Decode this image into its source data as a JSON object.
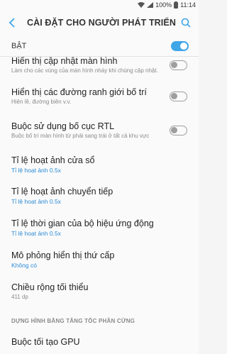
{
  "status": {
    "battery": "100%",
    "time": "11:14"
  },
  "appbar": {
    "title": "CÀI ĐẶT CHO NGƯỜI PHÁT TRIỂN"
  },
  "master": {
    "label": "BẬT"
  },
  "items": [
    {
      "title": "Hiển thị cập nhật màn hình",
      "subtitle": "Làm cho các vùng của màn hình nháy khi chúng cập nhật."
    },
    {
      "title": "Hiển thị các đường ranh giới bố trí",
      "subtitle": "Hiện lề, đường biên v.v."
    },
    {
      "title": "Buộc sử dụng bố cục RTL",
      "subtitle": "Buộc bố trí màn hình từ phải sang trái ở tất cả khu vực"
    },
    {
      "title": "Tỉ lệ hoạt ảnh cửa sổ",
      "value": "Tỉ lệ hoạt ảnh 0.5x"
    },
    {
      "title": "Tỉ lệ hoạt ảnh chuyển tiếp",
      "value": "Tỉ lệ hoạt ảnh 0.5x"
    },
    {
      "title": "Tỉ lệ thời gian của bộ hiệu ứng động",
      "value": "Tỉ lệ hoạt ảnh 0.5x"
    },
    {
      "title": "Mô phỏng hiển thị thứ cấp",
      "value": "Không có"
    },
    {
      "title": "Chiều rộng tối thiểu",
      "subtitle": "411 dp"
    }
  ],
  "section": {
    "label": "DỰNG HÌNH BẰNG TĂNG TỐC PHẦN CỨNG"
  },
  "last_item": {
    "title": "Buộc tối tạo GPU"
  }
}
